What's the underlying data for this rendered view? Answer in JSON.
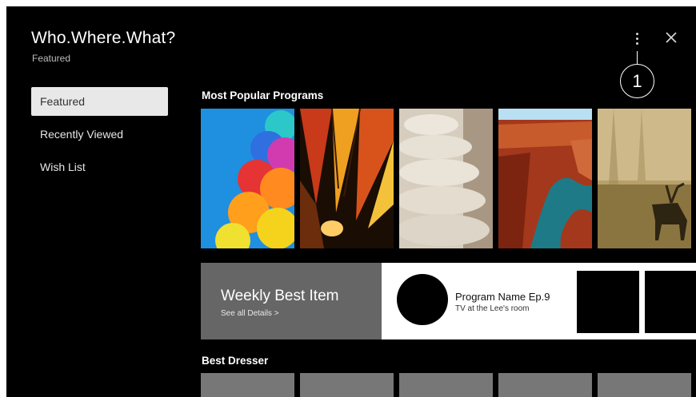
{
  "header": {
    "title": "Who.Where.What?",
    "subtitle": "Featured",
    "more_icon": "more-vertical-icon",
    "close_icon": "close-icon",
    "callout_number": "1"
  },
  "sidebar": {
    "items": [
      {
        "label": "Featured",
        "active": true
      },
      {
        "label": "Recently Viewed",
        "active": false
      },
      {
        "label": "Wish List",
        "active": false
      }
    ]
  },
  "most_popular": {
    "title": "Most Popular Programs",
    "posters": [
      "balloons",
      "hot-air-balloon",
      "stacked-stones",
      "canyon-river",
      "deer-in-fog"
    ]
  },
  "weekly_best": {
    "title": "Weekly Best Item",
    "link": "See all Details >"
  },
  "program": {
    "name": "Program Name Ep.9",
    "subtitle": "TV at the Lee's room"
  },
  "best_dresser": {
    "title": "Best Dresser"
  },
  "colors": {
    "background": "#000000",
    "active_item": "#e8e8e8",
    "weekly_panel": "#666666"
  }
}
